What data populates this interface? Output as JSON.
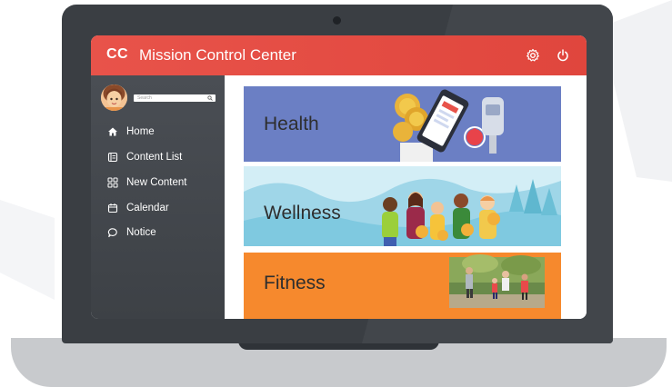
{
  "app": {
    "logo": "CC",
    "title": "Mission Control Center"
  },
  "toolbar": {
    "settings_icon": "gear-icon",
    "power_icon": "power-icon"
  },
  "search": {
    "placeholder": "Search"
  },
  "sidebar": {
    "items": [
      {
        "label": "Home",
        "icon": "home-icon"
      },
      {
        "label": "Content List",
        "icon": "list-icon"
      },
      {
        "label": "New Content",
        "icon": "grid-icon"
      },
      {
        "label": "Calendar",
        "icon": "calendar-icon"
      },
      {
        "label": "Notice",
        "icon": "chat-icon"
      }
    ]
  },
  "cards": [
    {
      "title": "Health",
      "color": "#6b7fc4"
    },
    {
      "title": "Wellness",
      "color": "#bfe6f2"
    },
    {
      "title": "Fitness",
      "color": "#f6892d"
    }
  ],
  "colors": {
    "accent": "#e8534a",
    "sidebar": "#44484e",
    "laptop_body": "#3a3e43",
    "laptop_base": "#c8cacd"
  }
}
